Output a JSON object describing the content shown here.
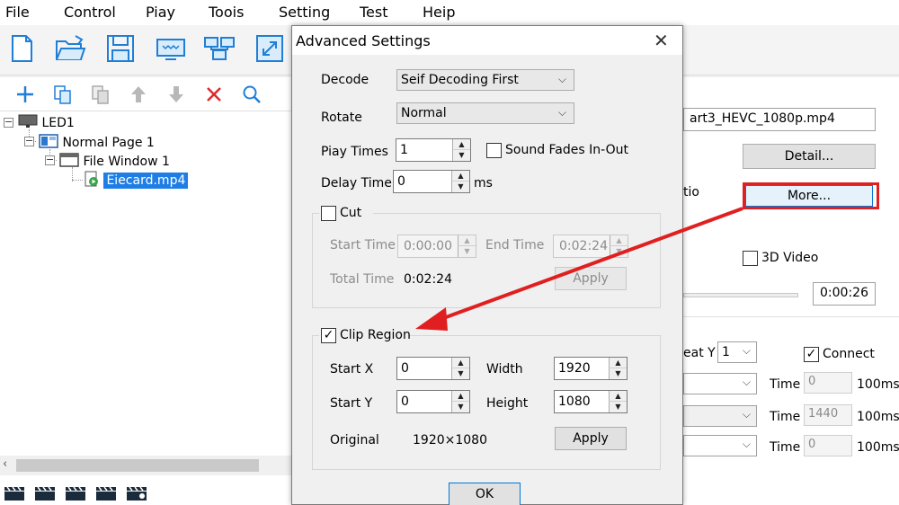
{
  "menu": [
    "File",
    "Control",
    "Piay",
    "Toois",
    "Setting",
    "Test",
    "Heip"
  ],
  "toolbar_icons": [
    "new-file-icon",
    "open-folder-icon",
    "save-icon",
    "screen-icon",
    "network-icon",
    "fullscreen-icon"
  ],
  "tree_tools": [
    "add-icon",
    "copy-icon",
    "paste-icon",
    "move-up-icon",
    "move-down-icon",
    "delete-icon",
    "search-icon"
  ],
  "tree": {
    "led": "LED1",
    "page": "Normal Page 1",
    "window": "File Window 1",
    "file": "Eiecard.mp4"
  },
  "right_panel": {
    "filename": "art3_HEVC_1080p.mp4",
    "detail_label": "Detail...",
    "more_label": "More...",
    "ratio_label": "tio",
    "video3d_label": "3D Video",
    "video3d_checked": false,
    "duration": "0:00:26",
    "repeat_label": "eat Y",
    "repeat_value": "1",
    "connect_label": "Connect",
    "connect_checked": true,
    "time_label": "Time",
    "time_values": [
      "0",
      "1440",
      "0"
    ],
    "unit": "100ms"
  },
  "dialog": {
    "title": "Advanced Settings",
    "decode_label": "Decode",
    "decode_value": "Seif Decoding First",
    "rotate_label": "Rotate",
    "rotate_value": "Normal",
    "play_times_label": "Piay Times",
    "play_times_value": "1",
    "sound_fades_label": "Sound Fades In-Out",
    "sound_fades_checked": false,
    "delay_label": "Delay Time",
    "delay_value": "0",
    "delay_unit": "ms",
    "cut": {
      "label": "Cut",
      "checked": false,
      "start_label": "Start Time",
      "start_value": "0:00:00",
      "end_label": "End Time",
      "end_value": "0:02:24",
      "total_label": "Total Time",
      "total_value": "0:02:24",
      "apply_label": "Apply"
    },
    "clip": {
      "label": "Clip Region",
      "checked": true,
      "startx_label": "Start X",
      "startx_value": "0",
      "width_label": "Width",
      "width_value": "1920",
      "starty_label": "Start Y",
      "starty_value": "0",
      "height_label": "Height",
      "height_value": "1080",
      "original_label": "Original",
      "original_value": "1920×1080",
      "apply_label": "Apply"
    },
    "ok_label": "OK"
  },
  "colors": {
    "annotation": "#e02020",
    "selection": "#1e7ee6",
    "toolbar_icon": "#1f7fd6"
  }
}
